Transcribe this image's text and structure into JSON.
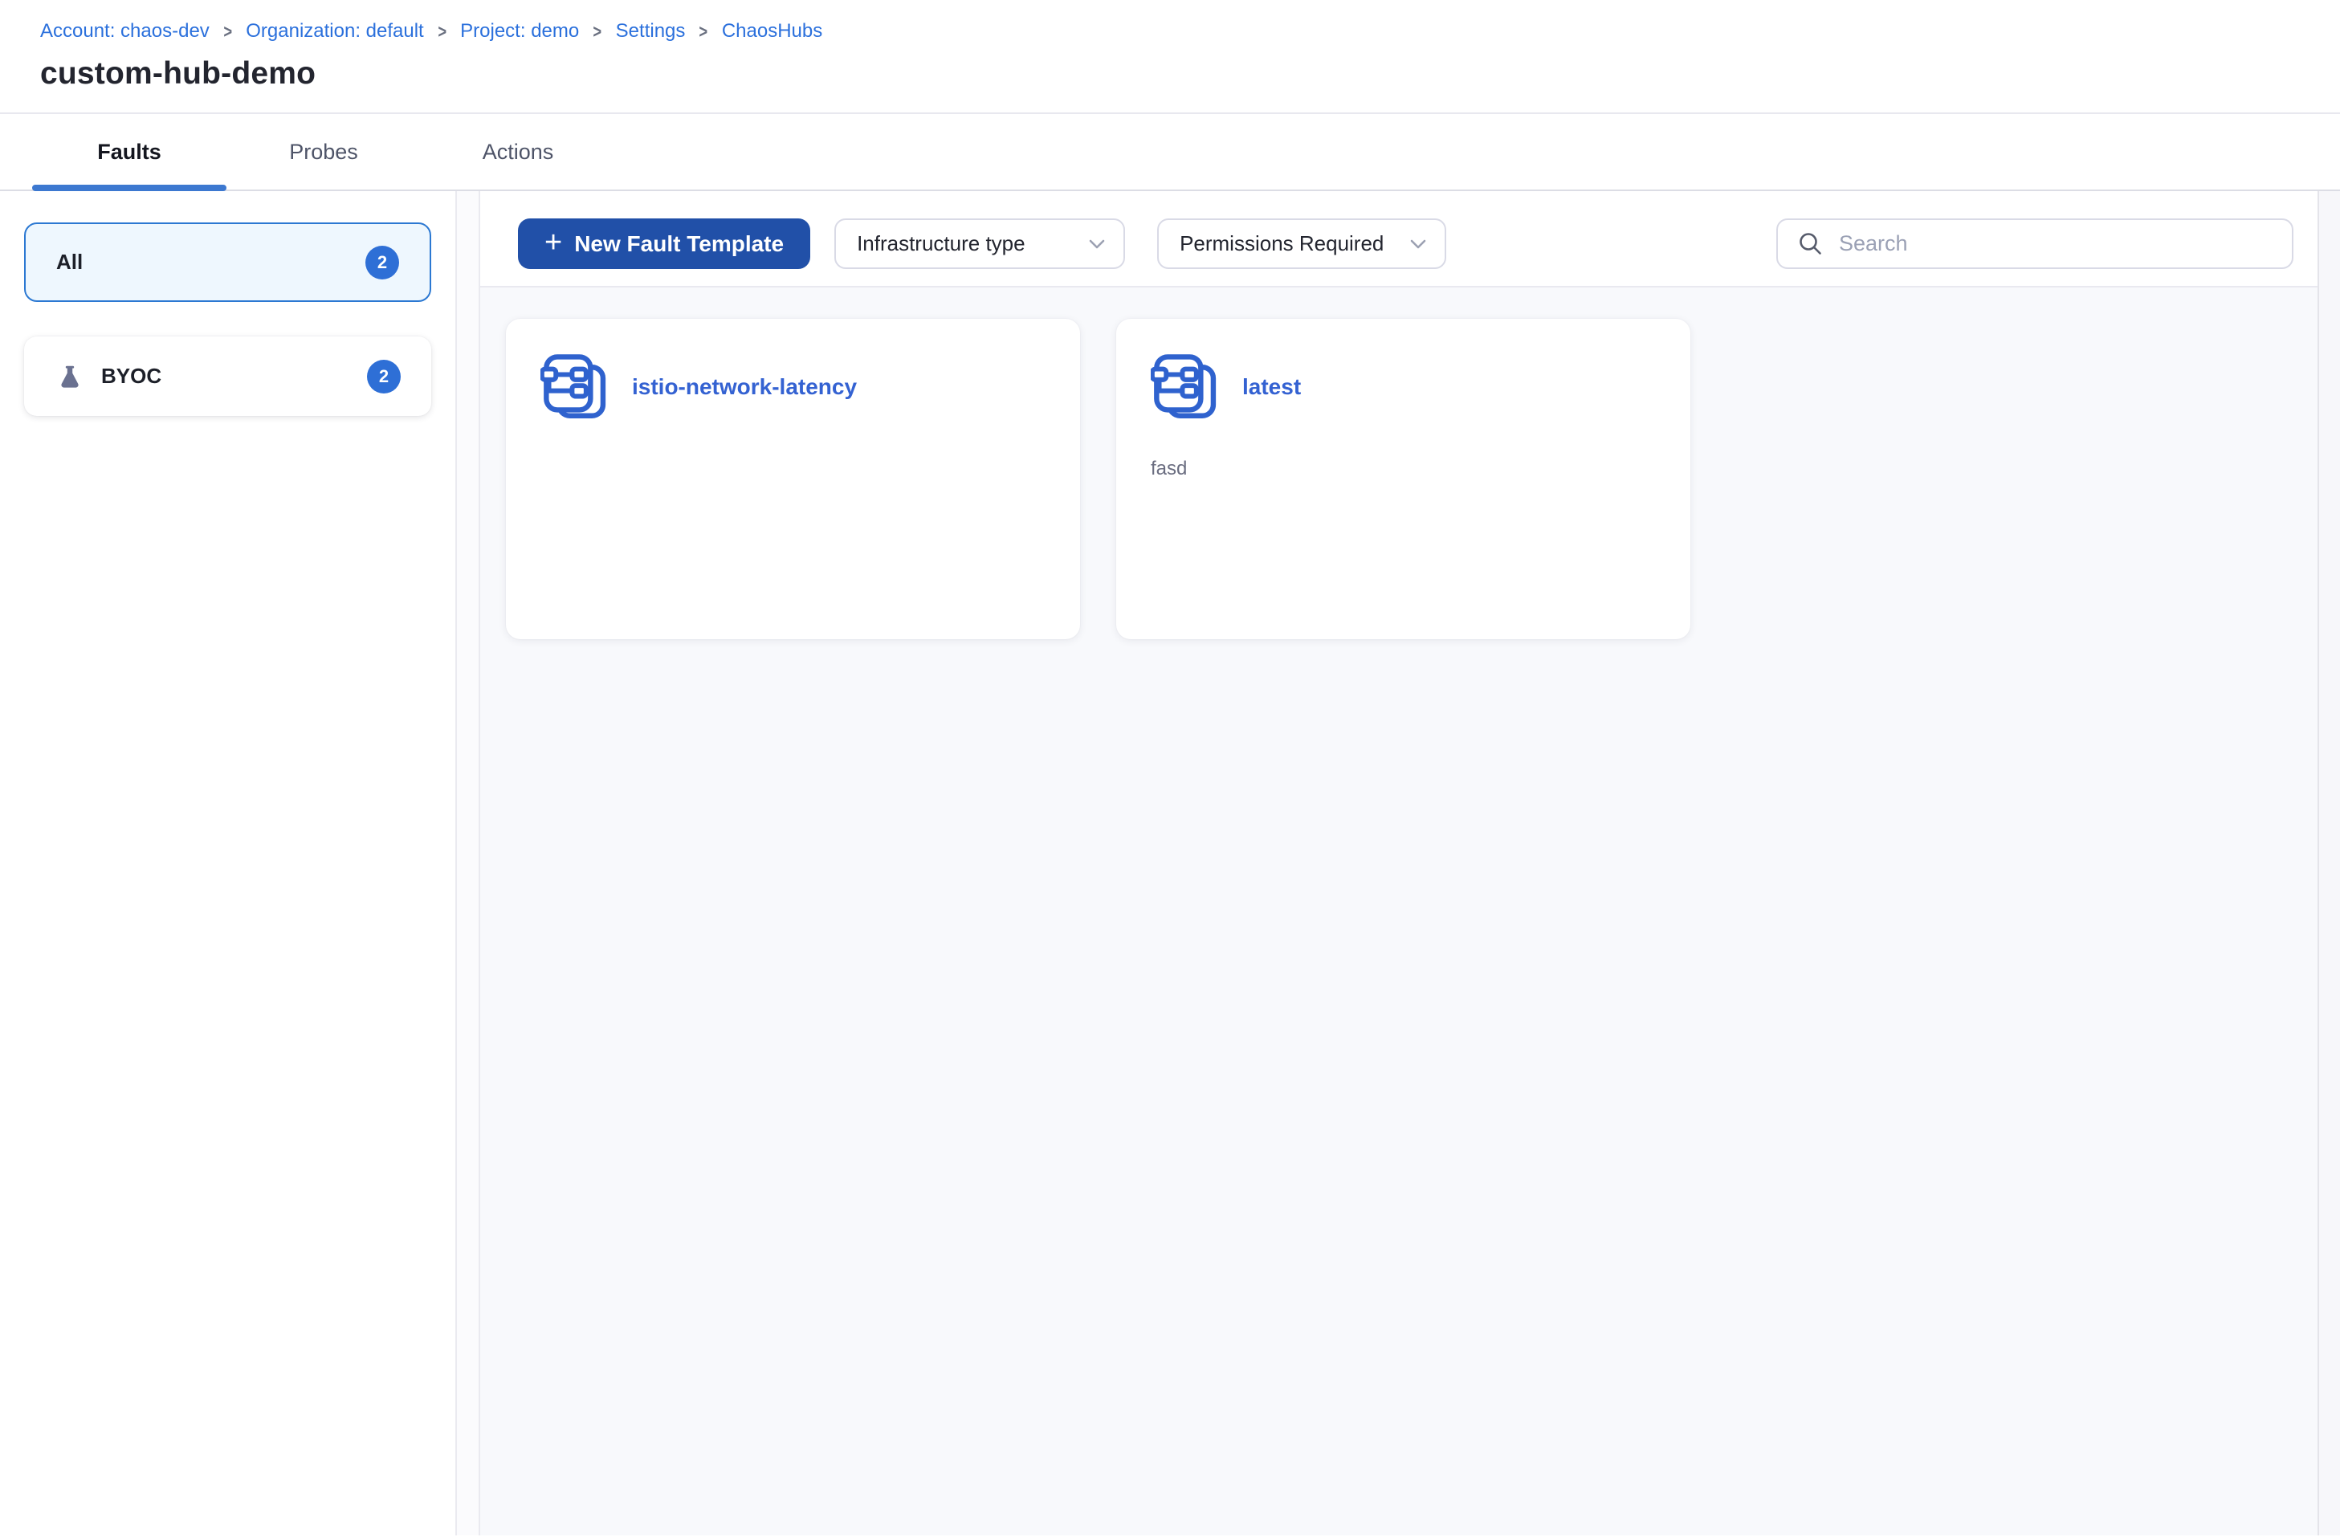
{
  "breadcrumb": {
    "separator": ">",
    "items": [
      {
        "label": "Account: chaos-dev"
      },
      {
        "label": "Organization: default"
      },
      {
        "label": "Project: demo"
      },
      {
        "label": "Settings"
      },
      {
        "label": "ChaosHubs"
      }
    ]
  },
  "page": {
    "title": "custom-hub-demo"
  },
  "tabs": [
    {
      "label": "Faults",
      "active": true
    },
    {
      "label": "Probes",
      "active": false
    },
    {
      "label": "Actions",
      "active": false
    }
  ],
  "sidebar": {
    "filters": [
      {
        "label": "All",
        "count": "2",
        "selected": true,
        "icon": "none"
      },
      {
        "label": "BYOC",
        "count": "2",
        "selected": false,
        "icon": "flask-icon"
      }
    ]
  },
  "toolbar": {
    "plus": "+",
    "new_template_label": "New Fault Template",
    "dropdowns": [
      {
        "label": "Infrastructure type"
      },
      {
        "label": "Permissions Required"
      }
    ],
    "search": {
      "placeholder": "Search"
    }
  },
  "cards": [
    {
      "title": "istio-network-latency",
      "description": ""
    },
    {
      "title": "latest",
      "description": "fasd"
    }
  ],
  "colors": {
    "link_blue": "#2B70DC",
    "card_title_blue": "#3462D2",
    "tab_underline_blue": "#3C78D0",
    "badge_blue": "#2E6FD6",
    "button_blue": "#2150A8",
    "selected_filter_bg": "#EEF7FE",
    "selected_filter_border": "#2B78D2",
    "content_bg": "#F8F9FC",
    "icon_blue": "#2F62CE",
    "flask_gray": "#6A7190"
  }
}
